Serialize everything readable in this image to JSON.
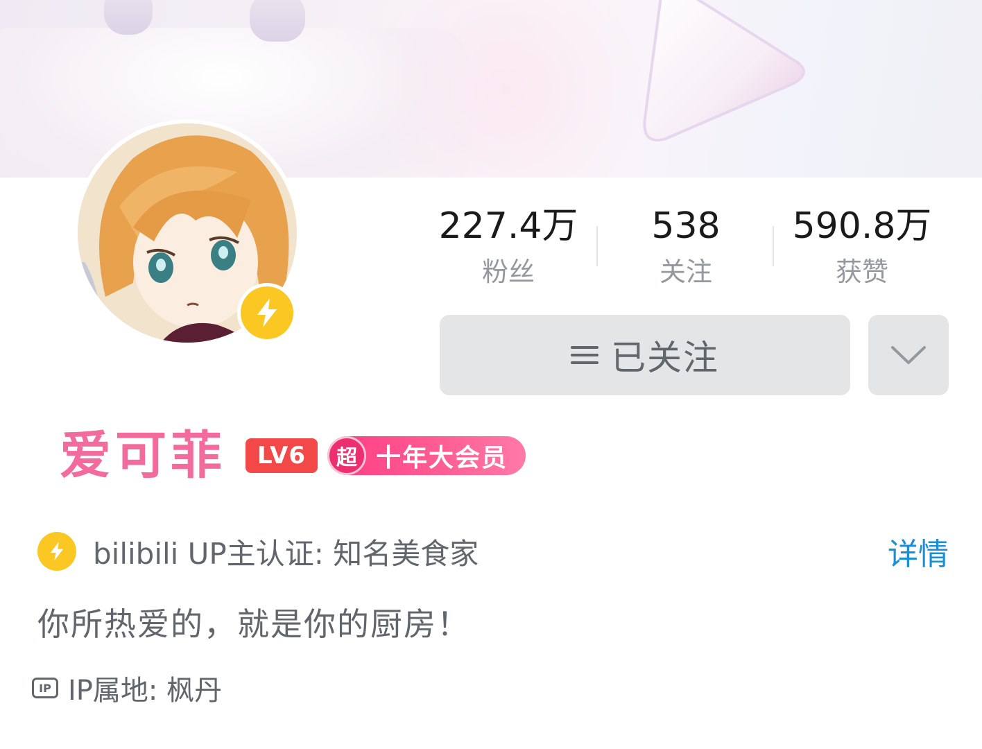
{
  "profile": {
    "name": "爱可菲",
    "level_badge": "LV6",
    "vip_badge_icon": "超",
    "vip_badge_text": "十年大会员",
    "name_color": "#f36a9c"
  },
  "stats": [
    {
      "value": "227.4万",
      "label": "粉丝"
    },
    {
      "value": "538",
      "label": "关注"
    },
    {
      "value": "590.8万",
      "label": "获赞"
    }
  ],
  "actions": {
    "follow_label": "已关注",
    "follow_icon": "menu-icon",
    "more_icon": "chevron-down-icon"
  },
  "certification": {
    "icon": "lightning-icon",
    "text": "bilibili UP主认证: 知名美食家",
    "detail_label": "详情"
  },
  "signature": "你所热爱的，就是你的厨房！",
  "ip": {
    "icon_label": "IP",
    "text": "IP属地: 枫丹"
  },
  "colors": {
    "accent_blue": "#1b8fd6",
    "verify_yellow": "#fbc823",
    "level_red": "#f24848",
    "vip_pink": "#ff3c83"
  }
}
